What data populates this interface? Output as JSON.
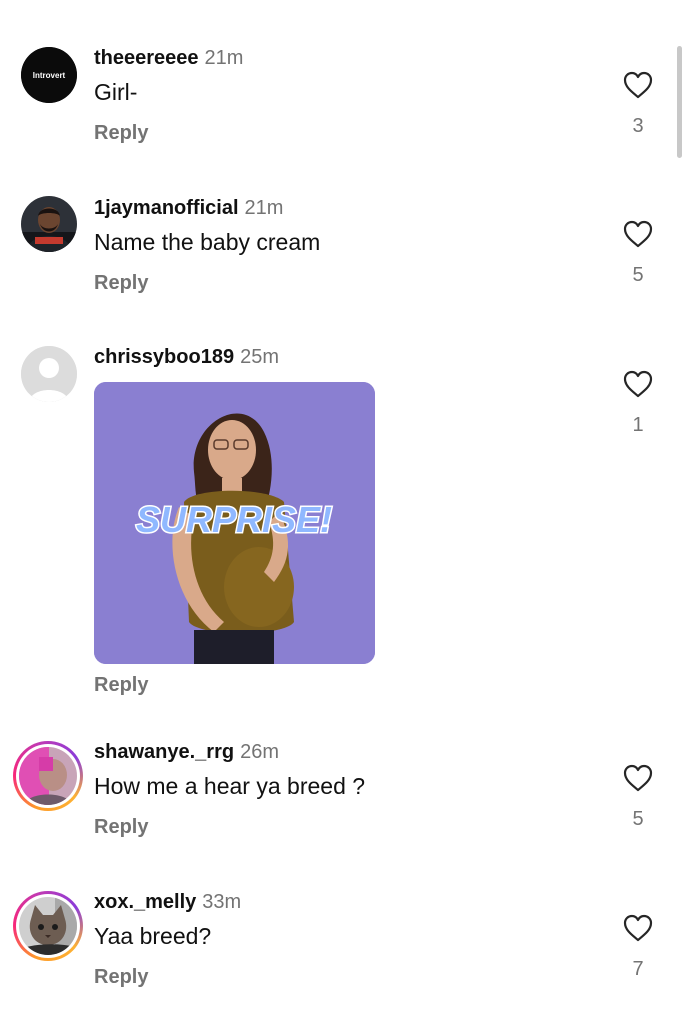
{
  "comments": [
    {
      "username": "theeereeee",
      "time": "21m",
      "text": "Girl-",
      "reply_label": "Reply",
      "likes": "3",
      "avatar_label": "Introvert"
    },
    {
      "username": "1jaymanofficial",
      "time": "21m",
      "text": "Name the baby cream",
      "reply_label": "Reply",
      "likes": "5"
    },
    {
      "username": "chrissyboo189",
      "time": "25m",
      "gif_caption": "SURPRISE!",
      "reply_label": "Reply",
      "likes": "1"
    },
    {
      "username": "shawanye._rrg",
      "time": "26m",
      "text": "How me a hear ya breed ?",
      "reply_label": "Reply",
      "likes": "5"
    },
    {
      "username": "xox._melly",
      "time": "33m",
      "text": "Yaa breed?",
      "reply_label": "Reply",
      "likes": "7"
    }
  ],
  "icons": {
    "like": "heart-outline-icon"
  },
  "colors": {
    "secondary_text": "#737373",
    "story_ring_start": "#fd9a29",
    "story_ring_end": "#c13ab4",
    "gif_background": "#8a7fd1"
  }
}
